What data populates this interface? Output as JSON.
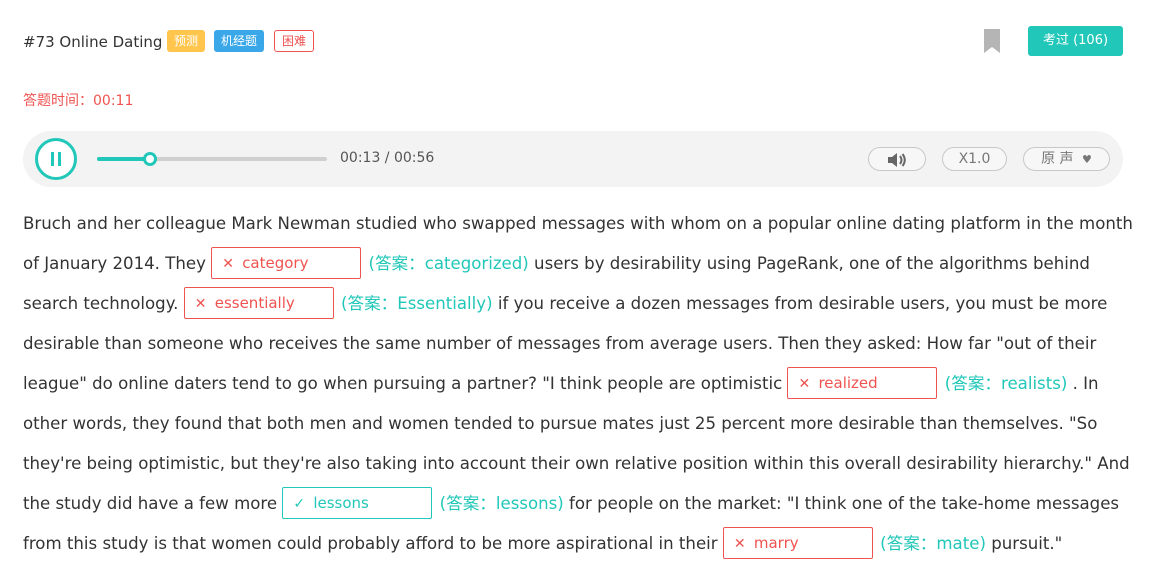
{
  "header": {
    "title": "#73 Online Dating",
    "tags": [
      "预测",
      "机经题",
      "困难"
    ],
    "exam_button": "考过 (106)"
  },
  "timer": "答题时间：00:11",
  "player": {
    "progress": 0.232,
    "time": "00:13 / 00:56",
    "speed": "X1.0",
    "voice": "原 声",
    "accent_color": "#21c7b8"
  },
  "passage": {
    "t0": "Bruch and her colleague Mark Newman studied who swapped messages with whom on a popular online dating platform in the month of January 2014. They ",
    "b1": {
      "answer": "category",
      "key": "(答案：categorized)",
      "correct": false
    },
    "t1": " users by desirability using PageRank, one of the algorithms behind search technology. ",
    "b2": {
      "answer": "essentially",
      "key": "(答案：Essentially)",
      "correct": false
    },
    "t2": " if you receive a dozen messages from desirable users, you must be more desirable than someone who receives the same number of messages from average users. Then they asked: How far \"out of their league\" do online daters tend to go when pursuing a partner? \"I think people are optimistic ",
    "b3": {
      "answer": "realized",
      "key": "(答案：realists)",
      "correct": false
    },
    "t3": " . In other words, they found that both men and women tended to pursue mates just 25 percent more desirable than themselves. \"So they're being optimistic, but they're also taking into account their own relative position within this overall desirability hierarchy.\" And the study did have a few more ",
    "b4": {
      "answer": "lessons",
      "key": "(答案：lessons)",
      "correct": true
    },
    "t4": " for people on the market: \"I think one of the take-home messages from this study is that women could probably afford to be more aspirational in their ",
    "b5": {
      "answer": "marry",
      "key": "(答案：mate)",
      "correct": false
    },
    "t5": " pursuit.\""
  }
}
